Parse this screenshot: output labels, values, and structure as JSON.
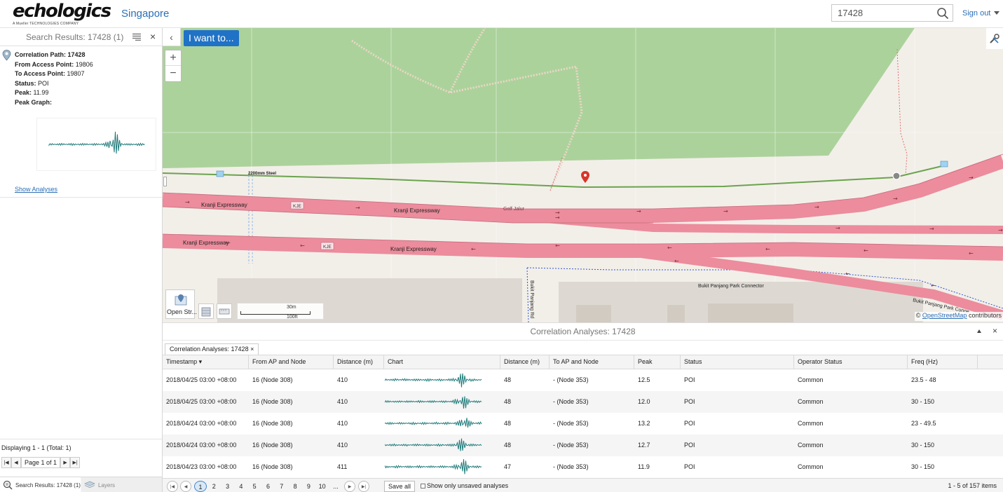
{
  "header": {
    "logo_text": "echologics",
    "logo_sub": "A Mueller TECHNOLOGIES COMPANY",
    "city": "Singapore",
    "search_value": "17428",
    "sign_out": "Sign out"
  },
  "left_panel": {
    "title": "Search Results: 17428 (1)",
    "close": "×",
    "result": {
      "path_label": "Correlation Path:",
      "path_value": "17428",
      "from_label": "From Access Point:",
      "from_value": "19806",
      "to_label": "To Access Point:",
      "to_value": "19807",
      "status_label": "Status:",
      "status_value": "POI",
      "peak_label": "Peak:",
      "peak_value": "11.99",
      "graph_label": "Peak Graph:",
      "show_analyses": "Show Analyses"
    },
    "displaying": "Displaying 1 - 1 (Total: 1)",
    "page_text": "Page 1 of 1",
    "tabs": {
      "search": "Search Results: 17428 (1)",
      "layers": "Layers"
    }
  },
  "map": {
    "i_want_to": "I want to...",
    "zoom_in": "+",
    "zoom_out": "−",
    "labels": {
      "pipe": "2200mm Steel",
      "kranji_1": "Kranji Expressway",
      "kranji_2": "Kranji Expressway",
      "kranji_3": "Kranji Expressway",
      "kranji_4": "Kranji Expressway",
      "kje_1": "KJE",
      "kje_2": "KJE",
      "golf": "Golf Jalur",
      "bukit_rd": "Bukit Panjang Rd",
      "connector_1": "Bukit Panjang Park Connector",
      "connector_2": "Bukit Panjang Park Conne"
    },
    "basemap_label": "Open Str...",
    "scale_m": "30m",
    "scale_ft": "100ft",
    "attribution_prefix": "©",
    "attribution_link": "OpenStreetMap",
    "attribution_suffix": "contributors",
    "colors": {
      "park": "#acd29b",
      "road": "#ec8c9c",
      "land": "#f2efe9",
      "pipe": "#6ba34d",
      "marker": "#d9342b"
    }
  },
  "analyses": {
    "title": "Correlation Analyses: 17428",
    "tab_label": "Correlation Analyses: 17428",
    "tab_close": "×",
    "columns": [
      "Timestamp ▾",
      "From AP and Node",
      "Distance (m)",
      "Chart",
      "Distance (m)",
      "To AP and Node",
      "Peak",
      "Status",
      "Operator Status",
      "Freq (Hz)"
    ],
    "rows": [
      {
        "timestamp": "2018/04/25 03:00 +08:00",
        "from": "16 (Node 308)",
        "dist1": "410",
        "dist2": "48",
        "to": "- (Node 353)",
        "peak": "12.5",
        "status": "POI",
        "op_status": "Common",
        "freq": "23.5 - 48"
      },
      {
        "timestamp": "2018/04/25 03:00 +08:00",
        "from": "16 (Node 308)",
        "dist1": "410",
        "dist2": "48",
        "to": "- (Node 353)",
        "peak": "12.0",
        "status": "POI",
        "op_status": "Common",
        "freq": "30 - 150"
      },
      {
        "timestamp": "2018/04/24 03:00 +08:00",
        "from": "16 (Node 308)",
        "dist1": "410",
        "dist2": "48",
        "to": "- (Node 353)",
        "peak": "13.2",
        "status": "POI",
        "op_status": "Common",
        "freq": "23 - 49.5"
      },
      {
        "timestamp": "2018/04/24 03:00 +08:00",
        "from": "16 (Node 308)",
        "dist1": "410",
        "dist2": "48",
        "to": "- (Node 353)",
        "peak": "12.7",
        "status": "POI",
        "op_status": "Common",
        "freq": "30 - 150"
      },
      {
        "timestamp": "2018/04/23 03:00 +08:00",
        "from": "16 (Node 308)",
        "dist1": "411",
        "dist2": "47",
        "to": "- (Node 353)",
        "peak": "11.9",
        "status": "POI",
        "op_status": "Common",
        "freq": "30 - 150"
      }
    ],
    "pager_numbers": [
      "1",
      "2",
      "3",
      "4",
      "5",
      "6",
      "7",
      "8",
      "9",
      "10",
      "..."
    ],
    "save_all": "Save all",
    "only_unsaved": "Show only unsaved analyses",
    "items": "1 - 5 of 157 items"
  }
}
